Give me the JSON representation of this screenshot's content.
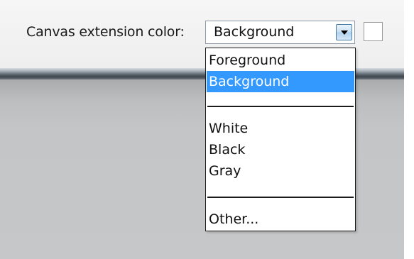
{
  "toolbar": {
    "label": "Canvas extension color:",
    "combo": {
      "value": "Background"
    },
    "checkbox": {
      "checked": false
    }
  },
  "dropdown": {
    "options": [
      {
        "label": "Foreground",
        "selected": false
      },
      {
        "label": "Background",
        "selected": true
      },
      {
        "label": "White",
        "selected": false
      },
      {
        "label": "Black",
        "selected": false
      },
      {
        "label": "Gray",
        "selected": false
      },
      {
        "label": "Other...",
        "selected": false
      }
    ]
  },
  "colors": {
    "selection": "#3399ff",
    "toolbar_bg": "#f2f2f2",
    "canvas_bg": "#c3c5c7"
  },
  "icons": {
    "combo_arrow": "chevron-down-icon"
  }
}
